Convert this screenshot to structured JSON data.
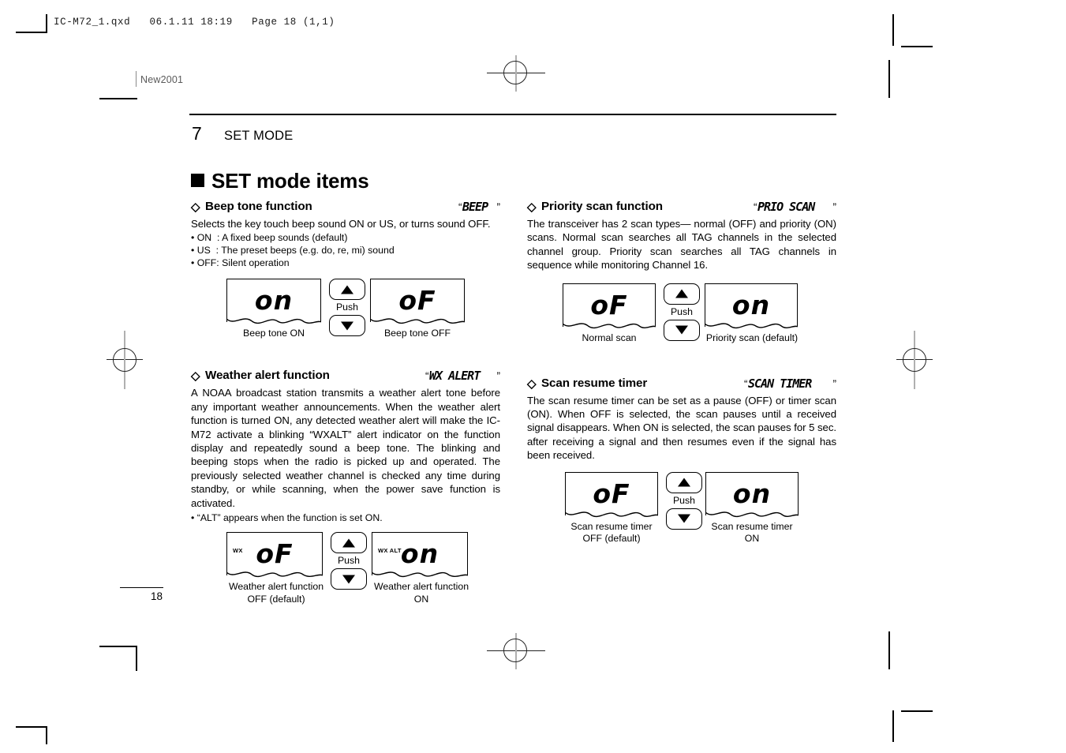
{
  "print_marks": {
    "file_header": "IC-M72_1.qxd   06.1.11 18:19   Page 18 (1,1)",
    "stamp": "New2001",
    "page_number": "18"
  },
  "chapter": {
    "number": "7",
    "title": "SET MODE"
  },
  "page_title": "SET mode items",
  "sections": {
    "beep_tone": {
      "diamond": "◇",
      "heading": "Beep tone function",
      "lcd_label": "“BEEP”",
      "body": "Selects the key touch beep sound ON or US, or turns sound OFF.",
      "bullets": [
        "• ON  : A fixed beep sounds (default)",
        "• US  : The preset beeps (e.g. do, re, mi) sound",
        "• OFF: Silent operation"
      ],
      "figure": {
        "left_display": "on",
        "left_caption": "Beep tone ON",
        "right_display": "oF",
        "right_caption": "Beep tone OFF",
        "push_label": "Push",
        "up_icon": "triangle-up-icon",
        "down_icon": "triangle-down-icon"
      }
    },
    "weather_alert": {
      "diamond": "◇",
      "heading": "Weather alert function",
      "lcd_label": "“WX ALERT”",
      "body": "A NOAA broadcast station transmits a weather alert tone before any important weather announcements. When the weather alert function is turned ON, any detected weather alert will make the IC-M72 activate a blinking “WXALT” alert indicator on the function display and repeatedly sound a beep tone. The blinking and beeping stops when the radio is picked up and operated. The previously selected weather channel is checked any time during standby, or while scanning, when the power save function is activated.",
      "note": "• “ALT” appears when the function is set ON.",
      "figure": {
        "left_display": "oF",
        "left_flag": "WX",
        "left_caption": "Weather alert function\nOFF (default)",
        "right_display": "on",
        "right_flag": "WX ALT",
        "right_caption": "Weather alert function\nON",
        "push_label": "Push",
        "up_icon": "triangle-up-icon",
        "down_icon": "triangle-down-icon"
      }
    },
    "priority_scan": {
      "diamond": "◇",
      "heading": "Priority scan function",
      "lcd_label": "“PRIO SCAN”",
      "body": "The transceiver has 2 scan types— normal (OFF) and priority (ON) scans. Normal scan searches all TAG channels in the selected channel group. Priority scan searches all TAG channels in sequence while monitoring Channel 16.",
      "figure": {
        "left_display": "oF",
        "left_caption": "Normal scan",
        "right_display": "on",
        "right_caption": "Priority scan (default)",
        "push_label": "Push",
        "up_icon": "triangle-up-icon",
        "down_icon": "triangle-down-icon"
      }
    },
    "scan_resume": {
      "diamond": "◇",
      "heading": "Scan resume timer",
      "lcd_label": "“SCAN TIMER”",
      "body": "The scan resume timer can be set as a pause (OFF) or timer scan (ON). When OFF is selected, the scan pauses until a received signal disappears. When ON is selected, the scan pauses for 5 sec. after receiving a signal and then resumes even if the signal has been received.",
      "figure": {
        "left_display": "oF",
        "left_caption": "Scan resume timer\nOFF (default)",
        "right_display": "on",
        "right_caption": "Scan resume timer\nON",
        "push_label": "Push",
        "up_icon": "triangle-up-icon",
        "down_icon": "triangle-down-icon"
      }
    }
  }
}
